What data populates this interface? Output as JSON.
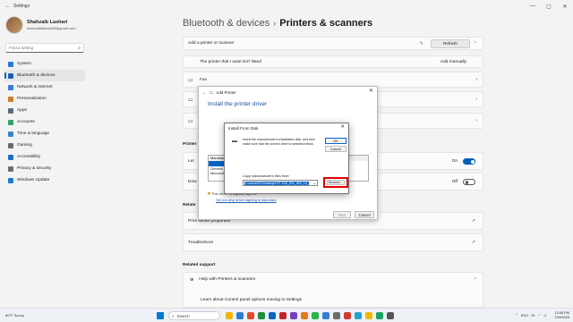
{
  "window": {
    "title": "Settings",
    "controls": [
      "—",
      "▢",
      "✕"
    ]
  },
  "profile": {
    "name": "Shahzaib Lashari",
    "email": "shahzaiblashari09@gmail.com"
  },
  "search": {
    "placeholder": "Find a setting"
  },
  "sidebar": {
    "items": [
      {
        "label": "System",
        "icon": "monitor-icon",
        "color": "#2b7cd3"
      },
      {
        "label": "Bluetooth & devices",
        "icon": "bluetooth-icon",
        "color": "#1f5fb4",
        "active": true
      },
      {
        "label": "Network & internet",
        "icon": "wifi-icon",
        "color": "#3a7bd5"
      },
      {
        "label": "Personalization",
        "icon": "brush-icon",
        "color": "#d4792a"
      },
      {
        "label": "Apps",
        "icon": "apps-icon",
        "color": "#5c6b7a"
      },
      {
        "label": "Accounts",
        "icon": "person-icon",
        "color": "#2fa36b"
      },
      {
        "label": "Time & language",
        "icon": "clock-icon",
        "color": "#3a86c8"
      },
      {
        "label": "Gaming",
        "icon": "gamepad-icon",
        "color": "#6b6b6b"
      },
      {
        "label": "Accessibility",
        "icon": "accessibility-icon",
        "color": "#1f6fc4"
      },
      {
        "label": "Privacy & security",
        "icon": "shield-icon",
        "color": "#6a6f77"
      },
      {
        "label": "Windows Update",
        "icon": "update-icon",
        "color": "#1f7ad1"
      }
    ]
  },
  "breadcrumb": {
    "parent": "Bluetooth & devices",
    "separator": "›",
    "current": "Printers & scanners"
  },
  "main": {
    "add_printer_label": "Add a printer or scanner",
    "refresh_label": "Refresh",
    "not_listed_label": "The printer that I want isn't listed",
    "add_manually_label": "Add manually",
    "fax_label": "Fax",
    "printer_prefs_partial": "Printer",
    "let_partial": "Let",
    "dow_partial": "Dow",
    "toggle_on_label": "On",
    "toggle_off_label": "Off",
    "related_partial": "Relate",
    "print_server_label": "Print server properties",
    "troubleshoot_label": "Troubleshoot",
    "related_support_label": "Related support",
    "help_label": "Help with Printers & scanners",
    "learn_label": "Learn about Control panel options moving to Settings"
  },
  "add_printer_dialog": {
    "header": "Add Printer",
    "title": "Install the printer driver",
    "list_header": "Manufactu",
    "list_items": [
      "Generic",
      "Microsoft"
    ],
    "note_signed": "This driver is digitally signed.",
    "note_link": "Tell me why driver signing is important",
    "next_label": "Next",
    "cancel_label": "Cancel"
  },
  "install_disk_dialog": {
    "title": "Install From Disk",
    "message": "Insert the manufacturer's installation disk, and then make sure that the correct drive is selected below.",
    "ok_label": "OK",
    "cancel_label": "Cancel",
    "copy_label": "Copy manufacturer's files from:",
    "path_value": "C:\\Users\\PC\\Desktop\\LTF-TEE_EN-_602_10_F-INTEL",
    "browse_label": "Browse..."
  },
  "taskbar": {
    "weather": "80°F Sunny",
    "search_placeholder": "Search",
    "tray": [
      "ENG",
      "IN"
    ],
    "time": "12:06 PM",
    "date": "7/18/2023",
    "app_colors": [
      "#f2b705",
      "#2b7cd3",
      "#e24a2b",
      "#1f8f3a",
      "#0a64c8",
      "#c8202b",
      "#7a3fbf",
      "#e07a1a",
      "#2bb24c",
      "#3a7bd5",
      "#6b6b6b",
      "#d43a2b",
      "#2b9fd3",
      "#f2b705",
      "#1aa260",
      "#555555"
    ]
  }
}
